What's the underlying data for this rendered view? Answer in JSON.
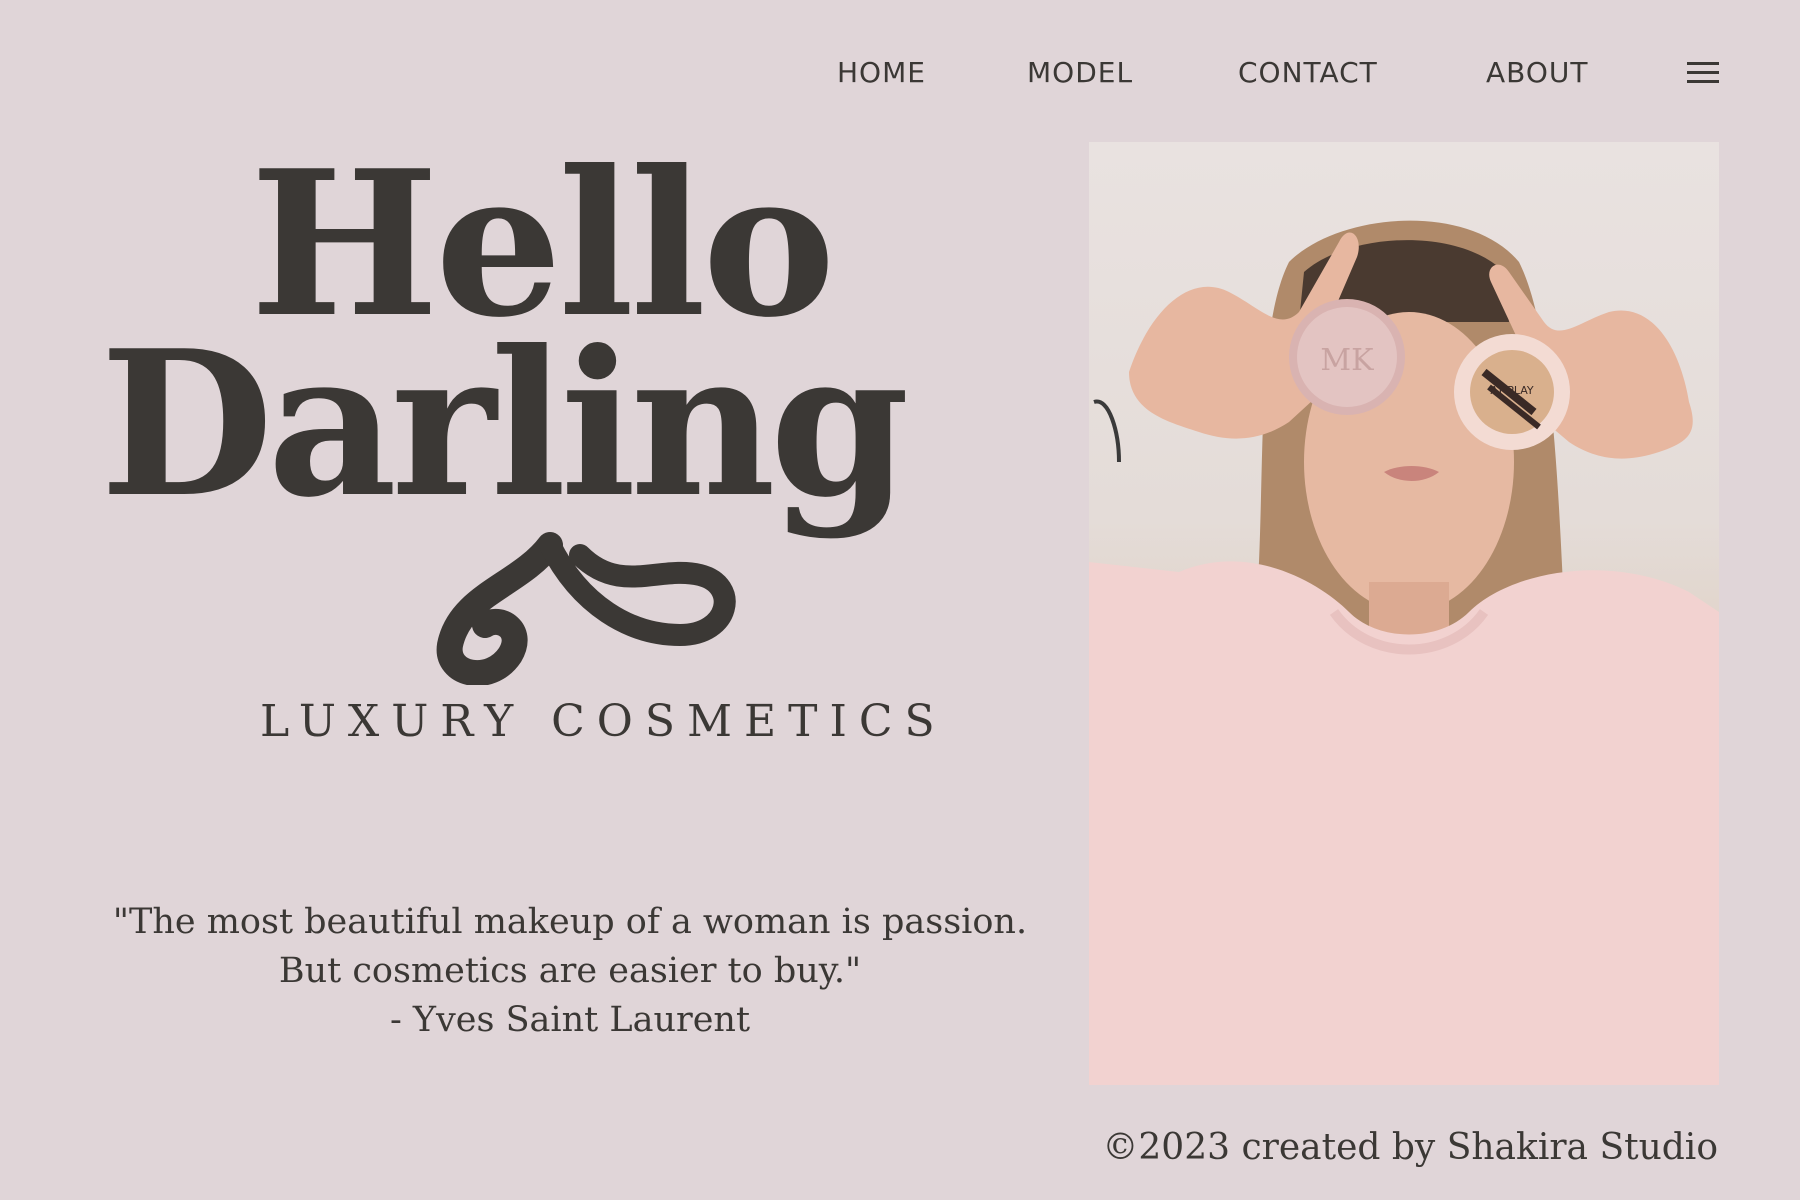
{
  "nav": {
    "items": [
      {
        "label": "HOME"
      },
      {
        "label": "MODEL"
      },
      {
        "label": "CONTACT"
      },
      {
        "label": "ABOUT"
      }
    ],
    "menu_icon": "hamburger-menu-icon"
  },
  "hero": {
    "line1": "Hello",
    "line2": "Darling",
    "subtitle": "LUXURY COSMETICS"
  },
  "quote": {
    "line1": "\"The most beautiful makeup of a woman is passion.",
    "line2": "But cosmetics are easier to buy.\"",
    "author": "- Yves Saint Laurent"
  },
  "photo": {
    "compact_left_text": "MK",
    "compact_right_text": "AT PLAY"
  },
  "footer": {
    "copyright": "©2023 created by Shakira Studio"
  },
  "colors": {
    "background": "#e0d5d8",
    "text": "#3b3835",
    "shirt": "#f2d2d0"
  }
}
